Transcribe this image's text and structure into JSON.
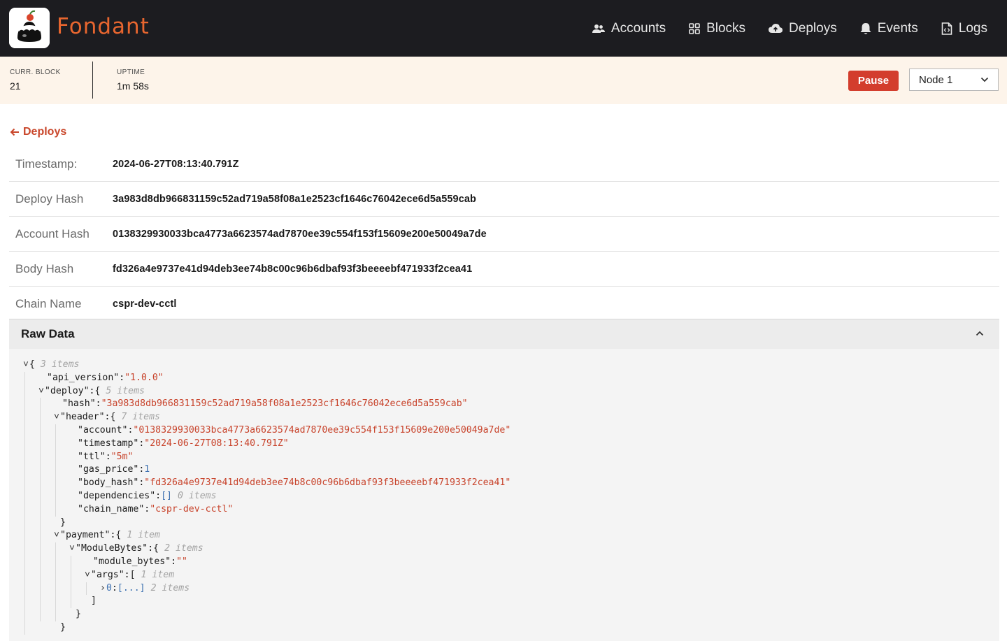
{
  "app": {
    "brand": "Fondant"
  },
  "nav": [
    {
      "label": "Accounts",
      "icon": "users-icon"
    },
    {
      "label": "Blocks",
      "icon": "grid-icon"
    },
    {
      "label": "Deploys",
      "icon": "cloud-upload-icon"
    },
    {
      "label": "Events",
      "icon": "bell-icon"
    },
    {
      "label": "Logs",
      "icon": "file-code-icon"
    }
  ],
  "status": {
    "curr_block_label": "CURR. BLOCK",
    "curr_block_value": "21",
    "uptime_label": "UPTIME",
    "uptime_value": "1m 58s",
    "pause_label": "Pause",
    "node_selected": "Node 1"
  },
  "back_link": "Deploys",
  "details": [
    {
      "label": "Timestamp:",
      "value": "2024-06-27T08:13:40.791Z"
    },
    {
      "label": "Deploy Hash",
      "value": "3a983d8db966831159c52ad719a58f08a1e2523cf1646c76042ece6d5a559cab"
    },
    {
      "label": "Account Hash",
      "value": "0138329930033bca4773a6623574ad7870ee39c554f153f15609e200e50049a7de"
    },
    {
      "label": "Body Hash",
      "value": "fd326a4e9737e41d94deb3ee74b8c00c96b6dbaf93f3beeeebf471933f2cea41"
    },
    {
      "label": "Chain Name",
      "value": "cspr-dev-cctl"
    }
  ],
  "raw_data": {
    "title": "Raw Data",
    "lines": [
      {
        "indent": 0,
        "toggle": "open",
        "key": "",
        "open": "{",
        "meta": "3 items"
      },
      {
        "indent": 1,
        "key": "\"api_version\"",
        "str": "\"1.0.0\""
      },
      {
        "indent": 1,
        "toggle": "open",
        "key": "\"deploy\"",
        "open": "{",
        "meta": "5 items"
      },
      {
        "indent": 2,
        "key": "\"hash\"",
        "str": "\"3a983d8db966831159c52ad719a58f08a1e2523cf1646c76042ece6d5a559cab\""
      },
      {
        "indent": 2,
        "toggle": "open",
        "key": "\"header\"",
        "open": "{",
        "meta": "7 items"
      },
      {
        "indent": 3,
        "key": "\"account\"",
        "str": "\"0138329930033bca4773a6623574ad7870ee39c554f153f15609e200e50049a7de\""
      },
      {
        "indent": 3,
        "key": "\"timestamp\"",
        "str": "\"2024-06-27T08:13:40.791Z\""
      },
      {
        "indent": 3,
        "key": "\"ttl\"",
        "str": "\"5m\""
      },
      {
        "indent": 3,
        "key": "\"gas_price\"",
        "num": "1"
      },
      {
        "indent": 3,
        "key": "\"body_hash\"",
        "str": "\"fd326a4e9737e41d94deb3ee74b8c00c96b6dbaf93f3beeeebf471933f2cea41\""
      },
      {
        "indent": 3,
        "key": "\"dependencies\"",
        "open": "[]",
        "meta": "0 items"
      },
      {
        "indent": 3,
        "key": "\"chain_name\"",
        "str": "\"cspr-dev-cctl\""
      },
      {
        "indent": 2,
        "close": "}"
      },
      {
        "indent": 2,
        "toggle": "open",
        "key": "\"payment\"",
        "open": "{",
        "meta": "1 item"
      },
      {
        "indent": 3,
        "toggle": "open",
        "key": "\"ModuleBytes\"",
        "open": "{",
        "meta": "2 items"
      },
      {
        "indent": 4,
        "key": "\"module_bytes\"",
        "str": "\"\""
      },
      {
        "indent": 4,
        "toggle": "open",
        "key": "\"args\"",
        "open": "[",
        "meta": "1 item"
      },
      {
        "indent": 5,
        "toggle": "closed",
        "key": "0",
        "open": "[...]",
        "meta": "2 items"
      },
      {
        "indent": 4,
        "close": "]"
      },
      {
        "indent": 3,
        "close": "}"
      },
      {
        "indent": 2,
        "close": "}"
      }
    ]
  },
  "colors": {
    "navbar_bg": "#1c1c20",
    "brand": "#e8662f",
    "accent_link": "#c9462a",
    "pause_btn": "#d33d2d",
    "status_bg": "#fdf4ea",
    "json_string": "#c8432b",
    "json_number": "#3b6fb0"
  }
}
